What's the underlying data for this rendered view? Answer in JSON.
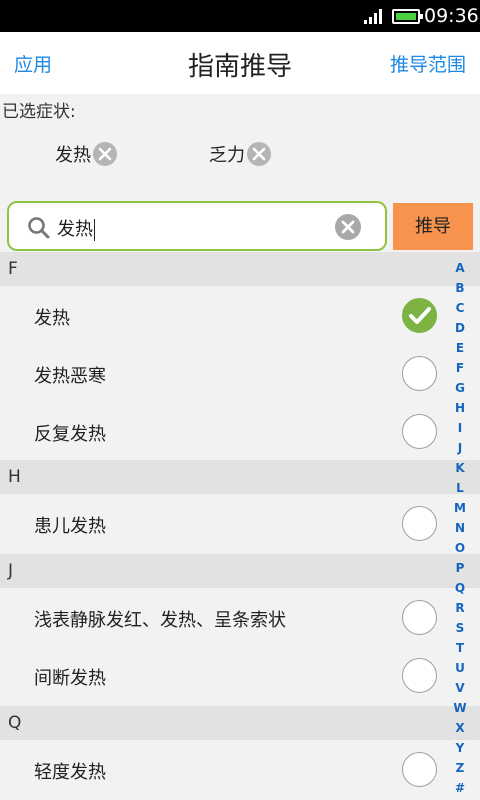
{
  "status_bar": {
    "time": "09:36",
    "battery_color": "#4cd041"
  },
  "header": {
    "left_label": "应用",
    "title": "指南推导",
    "right_label": "推导范围"
  },
  "selected": {
    "label": "已选症状:",
    "chips": [
      {
        "text": "发热"
      },
      {
        "text": "乏力"
      }
    ]
  },
  "search": {
    "value": "发热",
    "action_label": "推导",
    "icon": "search-icon"
  },
  "sections": [
    {
      "letter": "F",
      "items": [
        {
          "label": "发热",
          "checked": true
        },
        {
          "label": "发热恶寒",
          "checked": false
        },
        {
          "label": "反复发热",
          "checked": false
        }
      ]
    },
    {
      "letter": "H",
      "items": [
        {
          "label": "患儿发热",
          "checked": false
        }
      ]
    },
    {
      "letter": "J",
      "items": [
        {
          "label": "浅表静脉发红、发热、呈条索状",
          "checked": false
        },
        {
          "label": "间断发热",
          "checked": false
        }
      ]
    },
    {
      "letter": "Q",
      "items": [
        {
          "label": "轻度发热",
          "checked": false
        }
      ]
    }
  ],
  "index_letters": [
    "A",
    "B",
    "C",
    "D",
    "E",
    "F",
    "G",
    "H",
    "I",
    "J",
    "K",
    "L",
    "M",
    "N",
    "O",
    "P",
    "Q",
    "R",
    "S",
    "T",
    "U",
    "V",
    "W",
    "X",
    "Y",
    "Z",
    "#"
  ],
  "colors": {
    "accent": "#1e88e5",
    "search_border": "#8fc442",
    "derive_button": "#f7934d",
    "check_green": "#7cb342"
  }
}
